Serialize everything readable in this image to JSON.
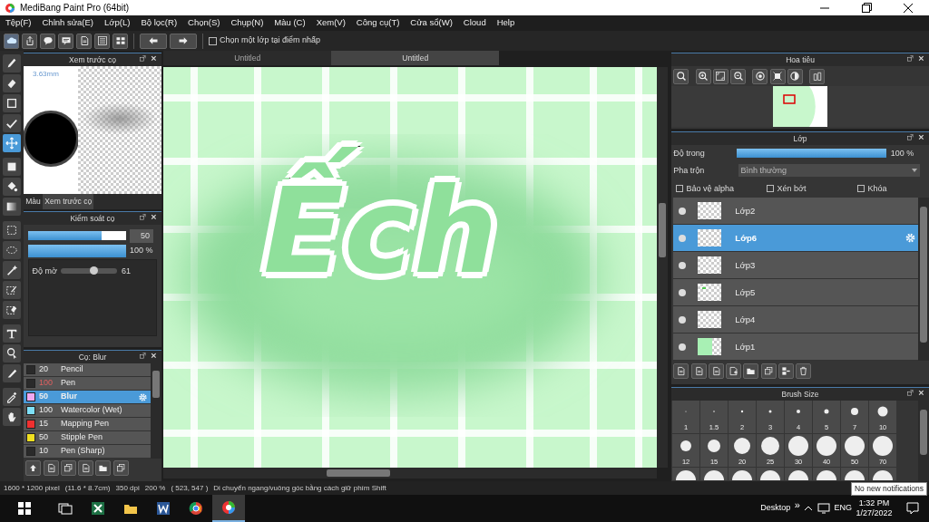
{
  "window": {
    "title": "MediBang Paint Pro (64bit)"
  },
  "menu": [
    "Tệp(F)",
    "Chỉnh sửa(E)",
    "Lớp(L)",
    "Bộ lọc(R)",
    "Chọn(S)",
    "Chụp(N)",
    "Màu (C)",
    "Xem(V)",
    "Công cụ(T)",
    "Cửa sổ(W)",
    "Cloud",
    "Help"
  ],
  "toolbar": {
    "pick_layer": {
      "label": "Chọn một lớp tại điểm nhấp",
      "checked": false
    }
  },
  "tools": [
    {
      "selected": false
    },
    {
      "selected": false
    },
    {
      "selected": false
    },
    {
      "selected": false
    },
    {
      "selected": true
    },
    {
      "selected": false
    },
    {
      "selected": false
    },
    {
      "selected": false
    },
    {
      "selected": false
    },
    {
      "selected": false
    },
    {
      "selected": false
    },
    {
      "selected": false
    },
    {
      "selected": false
    },
    {
      "selected": false
    },
    {
      "selected": false
    },
    {
      "selected": false
    },
    {
      "selected": false
    },
    {
      "selected": false
    }
  ],
  "brush_preview": {
    "title": "Xem trước cọ",
    "size": "3.63mm",
    "tabs": [
      {
        "label": "Màu",
        "selected": false
      },
      {
        "label": "Xem trước cọ",
        "selected": true
      }
    ]
  },
  "brush_control": {
    "title": "Kiểm soát cọ",
    "size": {
      "level": 0.75,
      "value": "50"
    },
    "opacity": {
      "reading": "100 %"
    },
    "blur": {
      "label": "Độ mờ",
      "level": 0.58,
      "reading": "61"
    }
  },
  "brushes": {
    "title": "Cọ: Blur",
    "items": [
      {
        "size": "20",
        "name": "Pencil",
        "color": "#2a2a2a",
        "alert": false,
        "selected": false
      },
      {
        "size": "100",
        "name": "Pen",
        "color": "#2a2a2a",
        "alert": true,
        "selected": false
      },
      {
        "size": "50",
        "name": "Blur",
        "color": "#f0a8f0",
        "alert": false,
        "selected": true
      },
      {
        "size": "100",
        "name": "Watercolor (Wet)",
        "color": "#7ee0f8",
        "alert": false,
        "selected": false
      },
      {
        "size": "15",
        "name": "Mapping Pen",
        "color": "#f03030",
        "alert": false,
        "selected": false
      },
      {
        "size": "50",
        "name": "Stipple Pen",
        "color": "#f0e020",
        "alert": false,
        "selected": false
      },
      {
        "size": "10",
        "name": "Pen (Sharp)",
        "color": "#2a2a2a",
        "alert": false,
        "selected": false
      }
    ]
  },
  "canvas": {
    "tabs": [
      {
        "label": "Untitled",
        "selected": false
      },
      {
        "label": "Untitled",
        "selected": true
      }
    ],
    "lettering": "Ếch"
  },
  "navigator": {
    "title": "Hoa tiêu"
  },
  "layers": {
    "title": "Lớp",
    "opacity": {
      "label": "Độ trong",
      "level": 1,
      "reading": "100 %"
    },
    "blend": {
      "label": "Pha trộn",
      "value": "Bình thường"
    },
    "options": [
      {
        "label": "Bảo vệ alpha",
        "checked": false
      },
      {
        "label": "Xén bớt",
        "checked": false
      },
      {
        "label": "Khóa",
        "checked": false
      }
    ],
    "items": [
      {
        "name": "Lớp2",
        "kind": "empty",
        "selected": false
      },
      {
        "name": "Lớp6",
        "kind": "empty",
        "selected": true
      },
      {
        "name": "Lớp3",
        "kind": "empty",
        "selected": false
      },
      {
        "name": "Lớp5",
        "kind": "mark",
        "selected": false
      },
      {
        "name": "Lớp4",
        "kind": "empty",
        "selected": false
      },
      {
        "name": "Lớp1",
        "kind": "fill",
        "selected": false
      }
    ]
  },
  "brush_size": {
    "title": "Brush Size",
    "sizes": [
      "1",
      "1.5",
      "2",
      "3",
      "4",
      "5",
      "7",
      "10",
      "12",
      "15",
      "20",
      "25",
      "30",
      "40",
      "50",
      "70"
    ]
  },
  "status_bar": [
    "1600 * 1200 pixel",
    "(11.6 * 8.7cm)",
    "350 dpi",
    "200 %",
    "( 523, 547 )",
    "Di chuyển ngang/vuông góc bằng cách giữ phím Shift"
  ],
  "tooltip": "No new notifications",
  "taskbar": {
    "apps": [
      {
        "selected": false
      },
      {
        "selected": false
      },
      {
        "selected": false
      },
      {
        "selected": false
      },
      {
        "selected": false
      },
      {
        "selected": true
      }
    ],
    "desktop": "Desktop",
    "chevron": "»",
    "language": "ENG",
    "time": "1:32 PM",
    "date": "1/27/2022"
  }
}
